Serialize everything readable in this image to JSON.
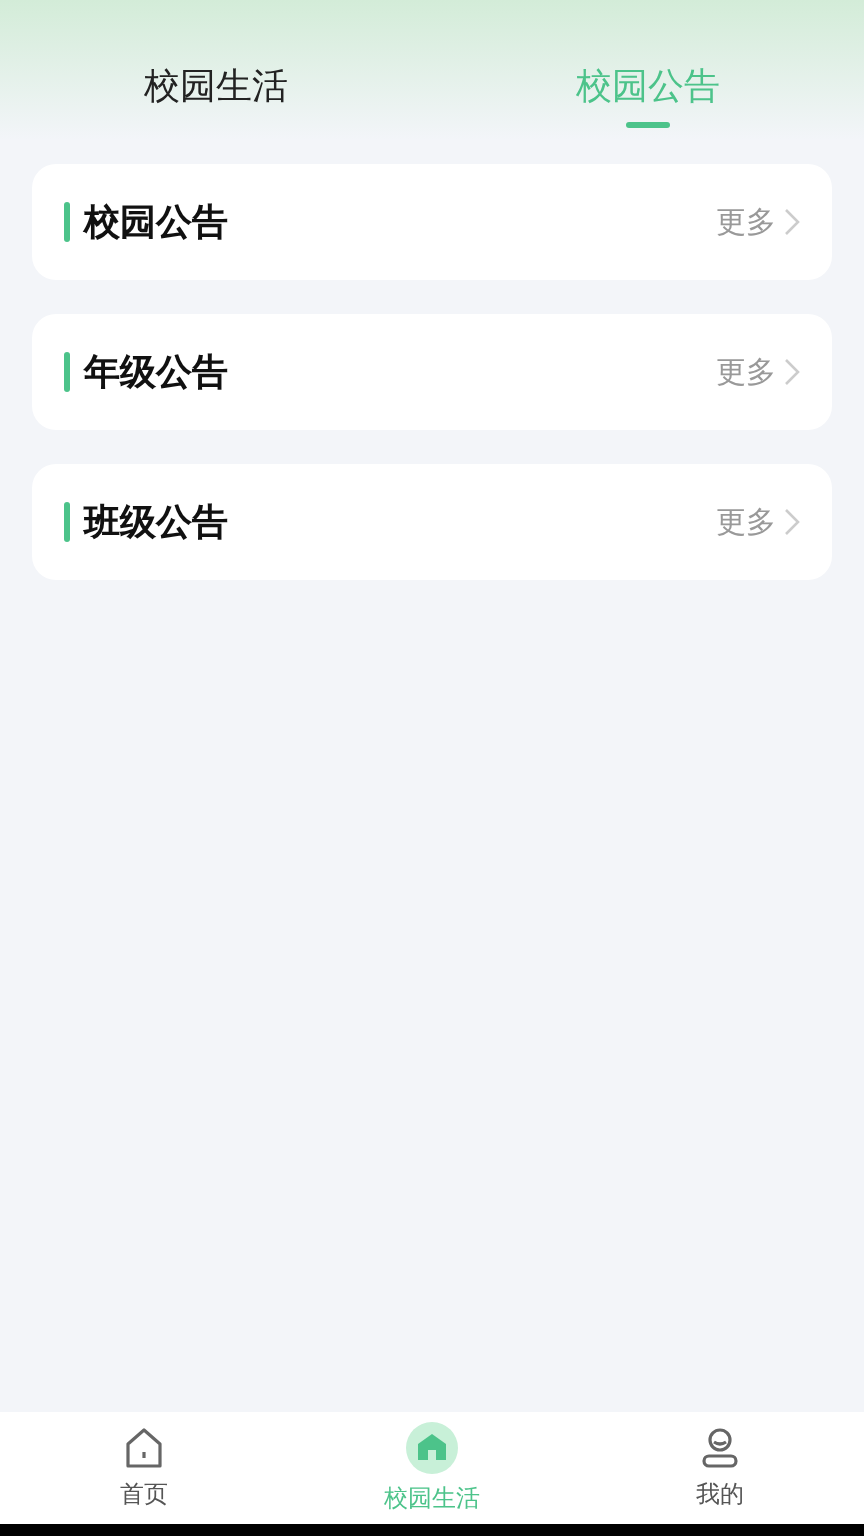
{
  "tabs": [
    {
      "label": "校园生活",
      "selected": false
    },
    {
      "label": "校园公告",
      "selected": true
    }
  ],
  "sections": [
    {
      "title": "校园公告",
      "more": "更多"
    },
    {
      "title": "年级公告",
      "more": "更多"
    },
    {
      "title": "班级公告",
      "more": "更多"
    }
  ],
  "bottom_nav": [
    {
      "kind": "home",
      "label": "首页",
      "selected": false
    },
    {
      "kind": "campus",
      "label": "校园生活",
      "selected": true
    },
    {
      "kind": "profile",
      "label": "我的",
      "selected": false
    }
  ]
}
